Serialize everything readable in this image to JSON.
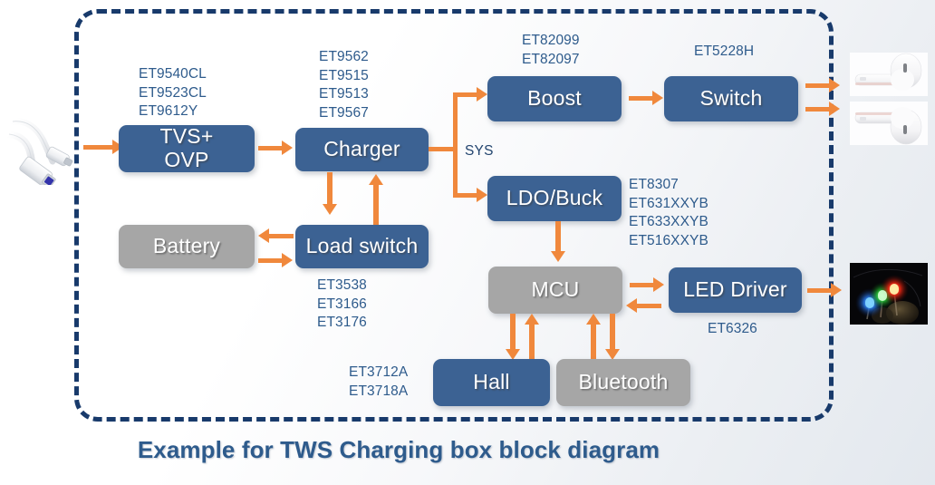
{
  "caption": "Example for TWS Charging box block diagram",
  "colors": {
    "block_blue": "#3C6293",
    "block_gray": "#A6A6A6",
    "arrow_orange": "#F0883C",
    "enclosure_navy": "#183A6B",
    "label_blue": "#2E5B8C"
  },
  "enclosure": {
    "style": "dashed",
    "label": "TWS charging box boundary"
  },
  "blocks": [
    {
      "id": "tvs_ovp",
      "label": "TVS+\nOVP",
      "color": "blue"
    },
    {
      "id": "charger",
      "label": "Charger",
      "color": "blue"
    },
    {
      "id": "battery",
      "label": "Battery",
      "color": "gray"
    },
    {
      "id": "load_switch",
      "label": "Load switch",
      "color": "blue"
    },
    {
      "id": "boost",
      "label": "Boost",
      "color": "blue"
    },
    {
      "id": "switch",
      "label": "Switch",
      "color": "blue"
    },
    {
      "id": "ldo_buck",
      "label": "LDO/Buck",
      "color": "blue"
    },
    {
      "id": "mcu",
      "label": "MCU",
      "color": "gray"
    },
    {
      "id": "led_driver",
      "label": "LED Driver",
      "color": "blue"
    },
    {
      "id": "hall",
      "label": "Hall",
      "color": "blue"
    },
    {
      "id": "bluetooth",
      "label": "Bluetooth",
      "color": "gray"
    }
  ],
  "part_labels": {
    "tvs_ovp": "ET9540CL\nET9523CL\nET9612Y",
    "charger": "ET9562\nET9515\nET9513\nET9567",
    "boost": "ET82099\nET82097",
    "switch": "ET5228H",
    "ldo_buck": "ET8307\nET631XXYB\nET633XXYB\nET516XXYB",
    "load_switch": "ET3538\nET3166\nET3176",
    "led_driver": "ET6326",
    "hall": "ET3712A\nET3718A"
  },
  "bus": {
    "sys": "SYS"
  },
  "photos": {
    "usb_cable": "usb-cable-photo",
    "earbud_top": "earbud-photo",
    "earbud_bottom": "earbud-photo",
    "leds": "rgb-leds-photo"
  }
}
